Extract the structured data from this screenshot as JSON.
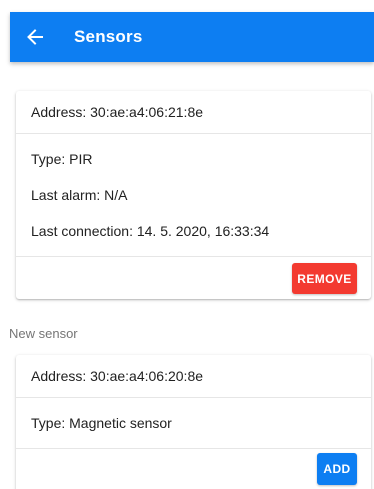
{
  "app_bar": {
    "title": "Sensors",
    "back_icon": "arrow-left-icon",
    "color": "#0d7ef2"
  },
  "sensor_card": {
    "address": "Address: 30:ae:a4:06:21:8e",
    "type": "Type: PIR",
    "last_alarm": "Last alarm: N/A",
    "last_connection": "Last connection: 14. 5. 2020, 16:33:34",
    "remove_label": "REMOVE",
    "remove_color": "#f33a30"
  },
  "new_sensor_section": {
    "label": "New sensor"
  },
  "new_sensor_card": {
    "address": "Address: 30:ae:a4:06:20:8e",
    "type": "Type: Magnetic sensor",
    "add_label": "ADD",
    "add_color": "#0d7ef2"
  }
}
